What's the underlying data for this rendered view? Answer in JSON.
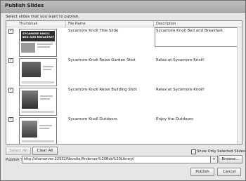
{
  "dialog": {
    "title": "Publish Slides",
    "instruction": "Select slides that you want to publish."
  },
  "columns": {
    "thumbnail": "Thumbnail",
    "file_name": "File Name",
    "description": "Description"
  },
  "slides": [
    {
      "checked": true,
      "check_glyph": "✓",
      "file_name": "Sycamore Knoll Title Slide",
      "description": "Sycamore Knoll Bed and Breakfast",
      "thumb_title": "SYCAMORE KNOLL BED AND BREAKFAST"
    },
    {
      "checked": true,
      "check_glyph": "✓",
      "file_name": "Sycamore Knoll Relax Garden Shot",
      "description": "Relax at Sycamore Knoll!"
    },
    {
      "checked": true,
      "check_glyph": "✓",
      "file_name": "Sycamore Knoll Relax Building Shot",
      "description": "Relax at Sycamore Knoll!"
    },
    {
      "checked": true,
      "check_glyph": "✓",
      "file_name": "Sycamore Knoll Outdoors",
      "description": "Enjoy the Outdoors"
    }
  ],
  "buttons": {
    "select_all": "Select All",
    "clear_all": "Clear All",
    "browse": "Browse...",
    "publish": "Publish",
    "cancel": "Cancel"
  },
  "show_only_selected": "Show Only Selected Slides",
  "publish_to": {
    "label": "Publish To:",
    "value": "http://sharserver:22932/Nevoite/Anderson%20Bde%20Library/"
  },
  "icons": {
    "dropdown": "chevron-down-icon"
  }
}
